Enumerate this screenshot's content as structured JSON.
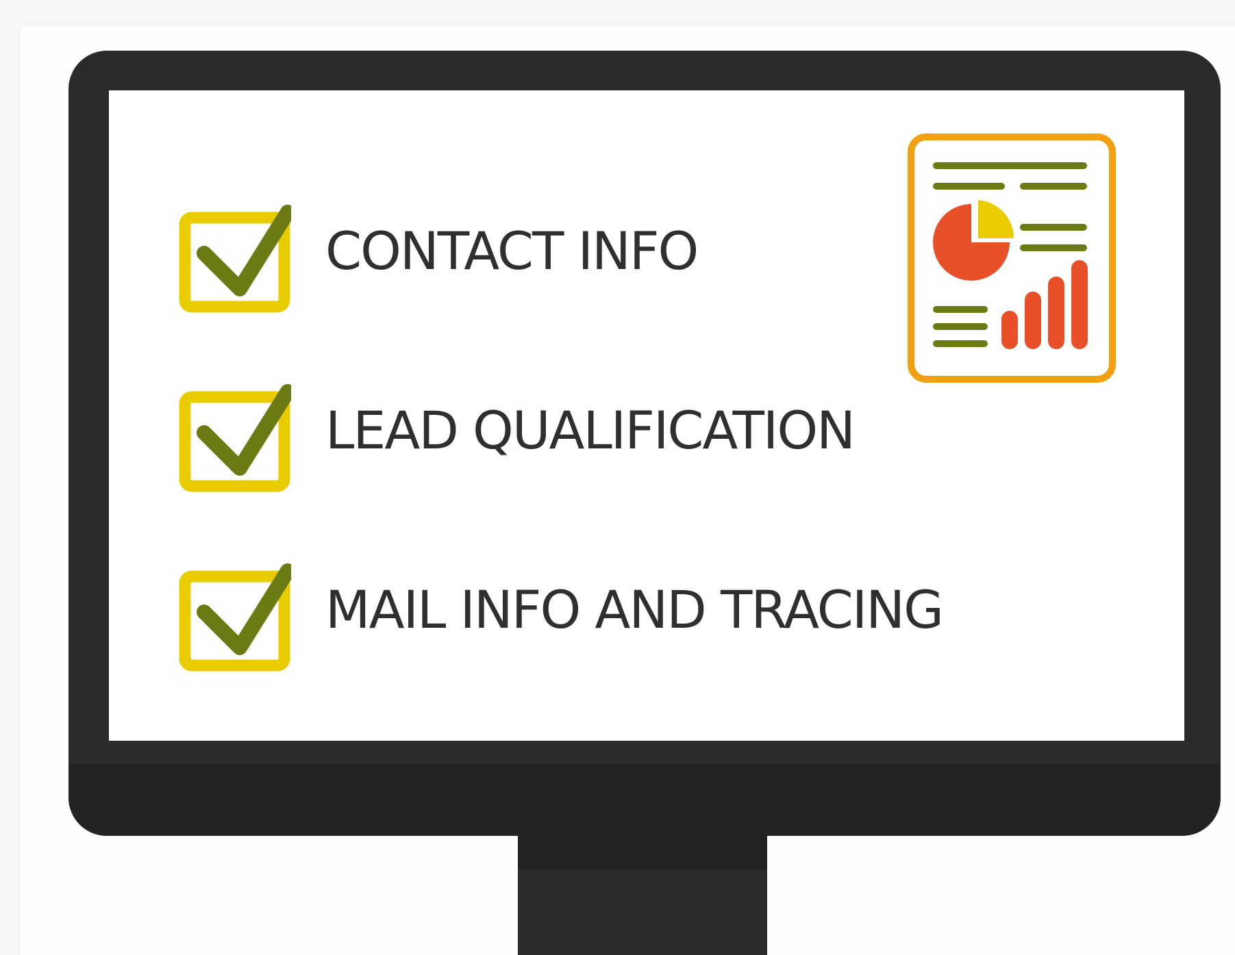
{
  "checklist": {
    "items": [
      {
        "label": "CONTACT INFO",
        "checked": true
      },
      {
        "label": "LEAD QUALIFICATION",
        "checked": true
      },
      {
        "label": "MAIL INFO AND TRACING",
        "checked": true
      }
    ]
  },
  "report_icon": {
    "icon": "report-dashboard-icon"
  },
  "colors": {
    "monitor": "#2b2b2b",
    "monitor_chin": "#232323",
    "screen": "#ffffff",
    "checkbox_border": "#e8cc00",
    "checkmark": "#6b7a12",
    "report_border": "#f0a010",
    "report_lines": "#6b7a12",
    "pie_main": "#e8502a",
    "pie_slice": "#e8cc00",
    "bars": "#e8502a",
    "label_text": "#2f2f2f"
  }
}
